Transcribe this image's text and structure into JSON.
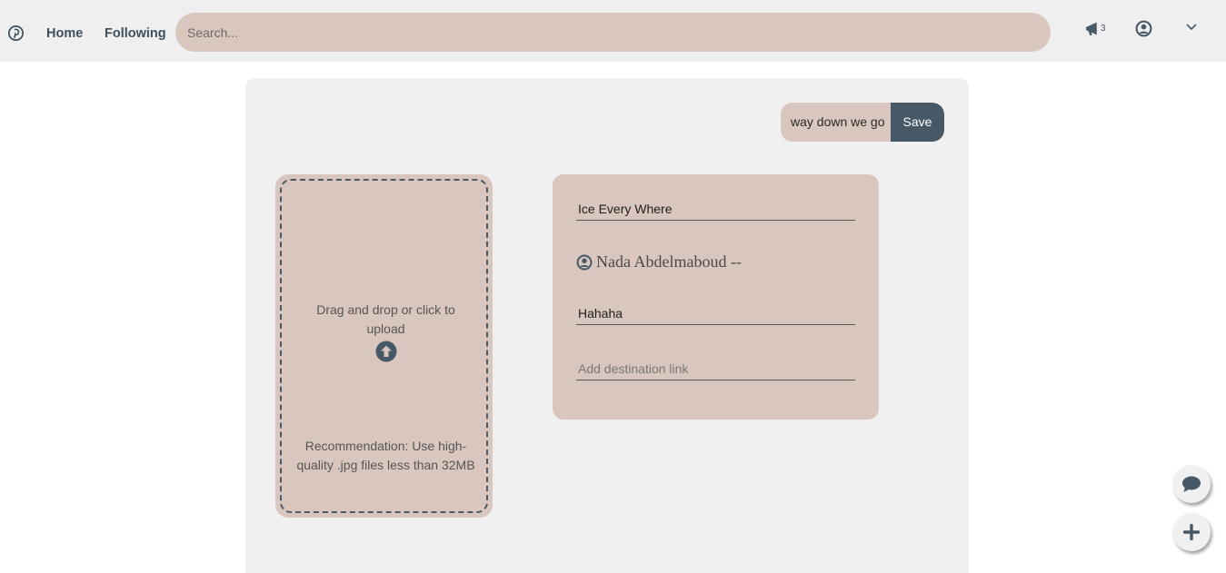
{
  "navbar": {
    "logo_icon": "pinterest-icon",
    "home_label": "Home",
    "following_label": "Following",
    "search_placeholder": "Search...",
    "notification_count": "3",
    "notification_icon": "megaphone-icon",
    "user_icon": "user-circle-icon",
    "menu_icon": "chevron-down-icon"
  },
  "pin_editor": {
    "board_name": "way down we go",
    "save_label": "Save",
    "upload": {
      "prompt": "Drag and drop or click to upload",
      "icon": "arrow-circle-up-icon",
      "recommendation": "Recommendation: Use high-quality .jpg files less than 32MB"
    },
    "details": {
      "title_value": "Ice Every Where",
      "author_name": "Nada Abdelmaboud --",
      "author_icon": "user-circle-icon",
      "description_value": "Hahaha",
      "link_placeholder": "Add destination link"
    }
  },
  "floating": {
    "chat_icon": "comment-icon",
    "add_icon": "plus-icon"
  },
  "colors": {
    "navbar_bg": "#efefef",
    "accent_beige": "#d9c7bf",
    "dark_slate": "#475966",
    "panel_bg": "#f0f0f0"
  }
}
